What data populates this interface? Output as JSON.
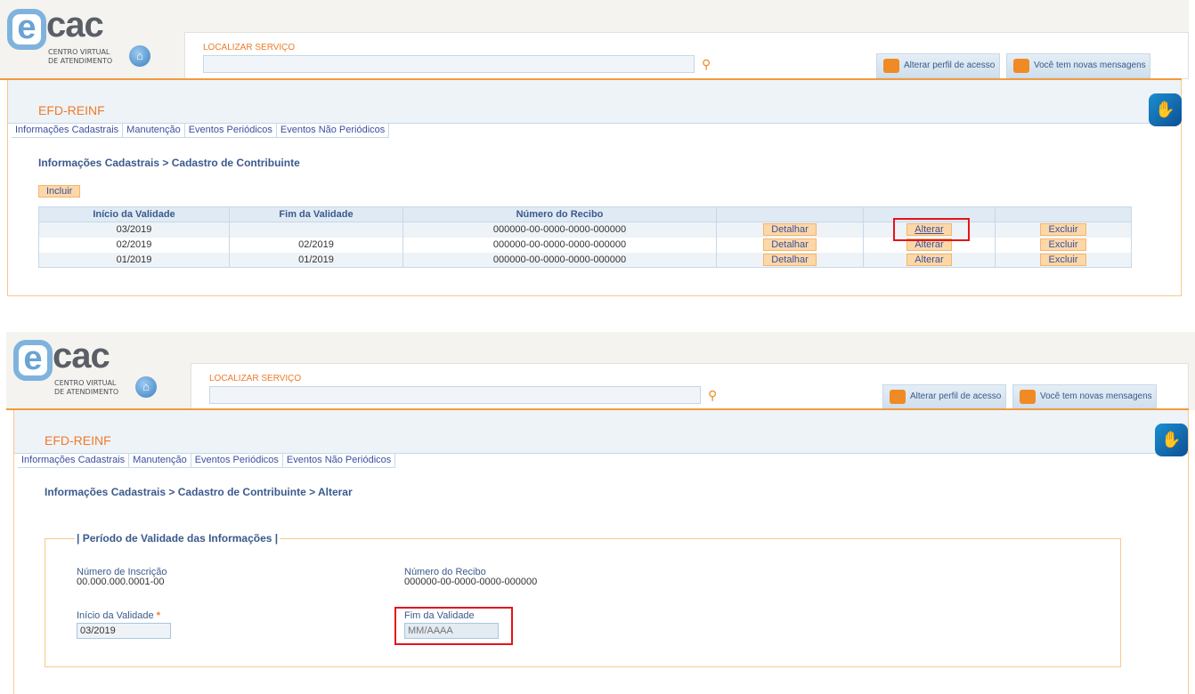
{
  "header": {
    "logo_text": "cac",
    "logo_subtitle_1": "CENTRO VIRTUAL",
    "logo_subtitle_2": "DE ATENDIMENTO",
    "search_label": "LOCALIZAR SERVIÇO",
    "search_value": "",
    "profile_button": "Alterar perfil de acesso",
    "messages_button": "Você tem novas mensagens"
  },
  "app_title": "EFD-REINF",
  "tabs": [
    "Informações Cadastrais",
    "Manutenção",
    "Eventos Periódicos",
    "Eventos Não Periódicos"
  ],
  "screen1": {
    "breadcrumb": "Informações Cadastrais > Cadastro de Contribuinte",
    "include_button": "Incluir",
    "columns": [
      "Início da Validade",
      "Fim da Validade",
      "Número do Recibo",
      "",
      "",
      ""
    ],
    "rows": [
      {
        "inicio": "03/2019",
        "fim": "",
        "recibo": "000000-00-0000-0000-000000"
      },
      {
        "inicio": "02/2019",
        "fim": "02/2019",
        "recibo": "000000-00-0000-0000-000000"
      },
      {
        "inicio": "01/2019",
        "fim": "01/2019",
        "recibo": "000000-00-0000-0000-000000"
      }
    ],
    "row_actions": {
      "detail": "Detalhar",
      "edit": "Alterar",
      "delete": "Excluir"
    }
  },
  "screen2": {
    "breadcrumb": "Informações Cadastrais > Cadastro de Contribuinte > Alterar",
    "fieldset_legend": "| Período de Validade das Informações |",
    "inscricao_label": "Número de Inscrição",
    "inscricao_value": "00.000.000.0001-00",
    "recibo_label": "Número do Recibo",
    "recibo_value": "000000-00-0000-0000-000000",
    "inicio_label": "Início da Validade",
    "required_mark": "*",
    "inicio_value": "03/2019",
    "fim_label": "Fim da Validade",
    "fim_value": "",
    "fim_placeholder": "MM/AAAA"
  },
  "colors": {
    "accent": "#f07a2a",
    "highlight": "#e3141b",
    "link": "#3a4fa0"
  }
}
